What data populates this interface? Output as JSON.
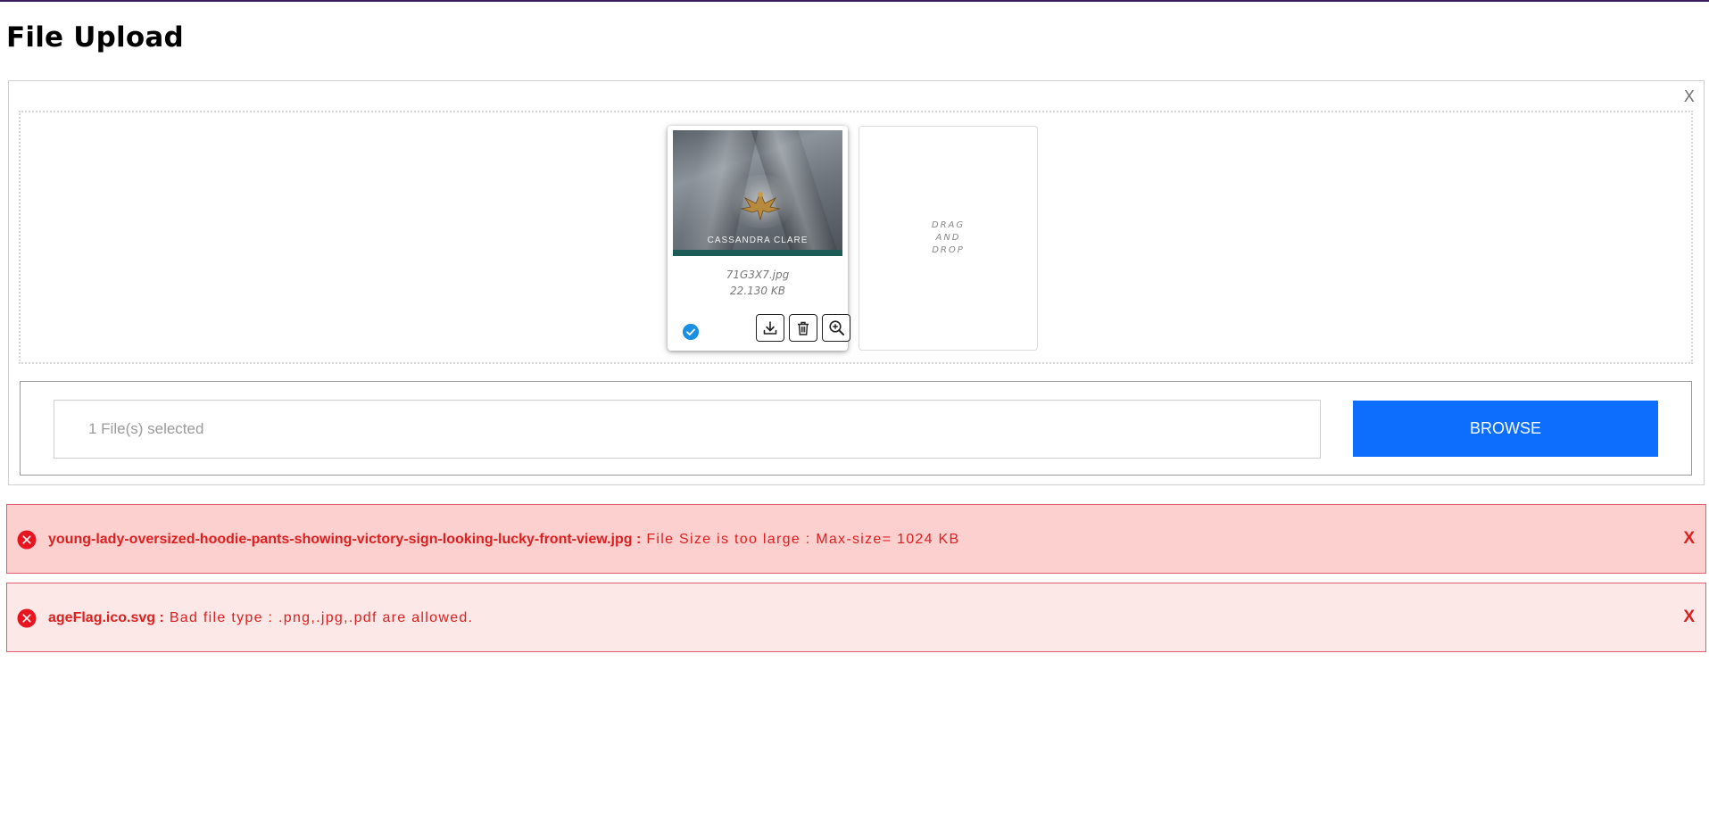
{
  "page": {
    "title": "File Upload"
  },
  "panel": {
    "close_label": "X"
  },
  "file_card": {
    "thumbnail": {
      "author_text": "CASSANDRA CLARE"
    },
    "file_name": "71G3X7.jpg",
    "file_size": "22.130 KB",
    "status_icon": "check-circle-icon",
    "actions": [
      {
        "icon": "download-icon"
      },
      {
        "icon": "trash-icon"
      },
      {
        "icon": "zoom-in-icon"
      }
    ]
  },
  "drag_drop": {
    "line1": "DRAG",
    "line2": "AND",
    "line3": "DROP"
  },
  "selector": {
    "selected_text": "1 File(s) selected",
    "browse_label": "BROWSE",
    "browse_color": "#0d6efd"
  },
  "alerts": [
    {
      "file": "young-lady-oversized-hoodie-pants-showing-victory-sign-looking-lucky-front-view.jpg :",
      "message": "File Size is too large : Max-size= 1024 KB",
      "close_label": "X",
      "icon": "error-circle-icon"
    },
    {
      "file": "ageFlag.ico.svg :",
      "message": "Bad file type : .png,.jpg,.pdf are allowed.",
      "close_label": "X",
      "icon": "error-circle-icon"
    }
  ],
  "colors": {
    "error_text": "#dc1f1f",
    "error_bg_1": "#fdd0d0",
    "error_bg_2": "#fde8e8",
    "check": "#1a8fe3"
  }
}
